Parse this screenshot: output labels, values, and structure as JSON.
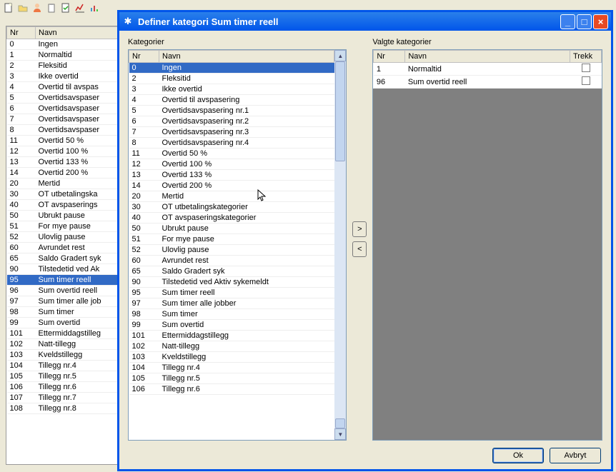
{
  "bgHeaders": {
    "nr": "Nr",
    "navn": "Navn"
  },
  "bgRows": [
    {
      "nr": "0",
      "navn": "Ingen"
    },
    {
      "nr": "1",
      "navn": "Normaltid"
    },
    {
      "nr": "2",
      "navn": "Fleksitid"
    },
    {
      "nr": "3",
      "navn": "Ikke overtid"
    },
    {
      "nr": "4",
      "navn": "Overtid til avspas"
    },
    {
      "nr": "5",
      "navn": "Overtidsavspaser"
    },
    {
      "nr": "6",
      "navn": "Overtidsavspaser"
    },
    {
      "nr": "7",
      "navn": "Overtidsavspaser"
    },
    {
      "nr": "8",
      "navn": "Overtidsavspaser"
    },
    {
      "nr": "11",
      "navn": "Overtid 50 %"
    },
    {
      "nr": "12",
      "navn": "Overtid 100 %"
    },
    {
      "nr": "13",
      "navn": "Overtid 133 %"
    },
    {
      "nr": "14",
      "navn": "Overtid 200 %"
    },
    {
      "nr": "20",
      "navn": "Mertid"
    },
    {
      "nr": "30",
      "navn": "OT utbetalingska"
    },
    {
      "nr": "40",
      "navn": "OT avspaserings"
    },
    {
      "nr": "50",
      "navn": "Ubrukt pause"
    },
    {
      "nr": "51",
      "navn": "For mye pause"
    },
    {
      "nr": "52",
      "navn": "Ulovlig pause"
    },
    {
      "nr": "60",
      "navn": "Avrundet rest"
    },
    {
      "nr": "65",
      "navn": "Saldo Gradert syk"
    },
    {
      "nr": "90",
      "navn": "Tilstedetid ved Ak"
    },
    {
      "nr": "95",
      "navn": "Sum timer reell",
      "selected": true
    },
    {
      "nr": "96",
      "navn": "Sum overtid reell"
    },
    {
      "nr": "97",
      "navn": "Sum timer alle job"
    },
    {
      "nr": "98",
      "navn": "Sum timer"
    },
    {
      "nr": "99",
      "navn": "Sum overtid"
    },
    {
      "nr": "101",
      "navn": "Ettermiddagstilleg"
    },
    {
      "nr": "102",
      "navn": "Natt-tillegg"
    },
    {
      "nr": "103",
      "navn": "Kveldstillegg"
    },
    {
      "nr": "104",
      "navn": "Tillegg nr.4"
    },
    {
      "nr": "105",
      "navn": "Tillegg nr.5"
    },
    {
      "nr": "106",
      "navn": "Tillegg nr.6"
    },
    {
      "nr": "107",
      "navn": "Tillegg nr.7"
    },
    {
      "nr": "108",
      "navn": "Tillegg nr.8"
    }
  ],
  "dialog": {
    "title": "Definer kategori Sum timer reell",
    "leftLabel": "Kategorier",
    "rightLabel": "Valgte kategorier",
    "ok": "Ok",
    "cancel": "Avbryt"
  },
  "leftHeaders": {
    "nr": "Nr",
    "navn": "Navn"
  },
  "leftRows": [
    {
      "nr": "0",
      "navn": "Ingen",
      "selected": true
    },
    {
      "nr": "2",
      "navn": "Fleksitid"
    },
    {
      "nr": "3",
      "navn": "Ikke overtid"
    },
    {
      "nr": "4",
      "navn": "Overtid til avspasering"
    },
    {
      "nr": "5",
      "navn": "Overtidsavspasering nr.1"
    },
    {
      "nr": "6",
      "navn": "Overtidsavspasering nr.2"
    },
    {
      "nr": "7",
      "navn": "Overtidsavspasering nr.3"
    },
    {
      "nr": "8",
      "navn": "Overtidsavspasering nr.4"
    },
    {
      "nr": "11",
      "navn": "Overtid 50 %"
    },
    {
      "nr": "12",
      "navn": "Overtid 100 %"
    },
    {
      "nr": "13",
      "navn": "Overtid 133 %"
    },
    {
      "nr": "14",
      "navn": "Overtid 200 %"
    },
    {
      "nr": "20",
      "navn": "Mertid"
    },
    {
      "nr": "30",
      "navn": "OT utbetalingskategorier"
    },
    {
      "nr": "40",
      "navn": "OT avspaseringskategorier"
    },
    {
      "nr": "50",
      "navn": "Ubrukt pause"
    },
    {
      "nr": "51",
      "navn": "For mye pause"
    },
    {
      "nr": "52",
      "navn": "Ulovlig pause"
    },
    {
      "nr": "60",
      "navn": "Avrundet rest"
    },
    {
      "nr": "65",
      "navn": "Saldo Gradert syk"
    },
    {
      "nr": "90",
      "navn": "Tilstedetid ved Aktiv sykemeldt"
    },
    {
      "nr": "95",
      "navn": "Sum timer reell"
    },
    {
      "nr": "97",
      "navn": "Sum timer alle jobber"
    },
    {
      "nr": "98",
      "navn": "Sum timer"
    },
    {
      "nr": "99",
      "navn": "Sum overtid"
    },
    {
      "nr": "101",
      "navn": "Ettermiddagstillegg"
    },
    {
      "nr": "102",
      "navn": "Natt-tillegg"
    },
    {
      "nr": "103",
      "navn": "Kveldstillegg"
    },
    {
      "nr": "104",
      "navn": "Tillegg nr.4"
    },
    {
      "nr": "105",
      "navn": "Tillegg nr.5"
    },
    {
      "nr": "106",
      "navn": "Tillegg nr.6"
    }
  ],
  "rightHeaders": {
    "nr": "Nr",
    "navn": "Navn",
    "trekk": "Trekk"
  },
  "rightRows": [
    {
      "nr": "1",
      "navn": "Normaltid"
    },
    {
      "nr": "96",
      "navn": "Sum overtid reell"
    }
  ]
}
